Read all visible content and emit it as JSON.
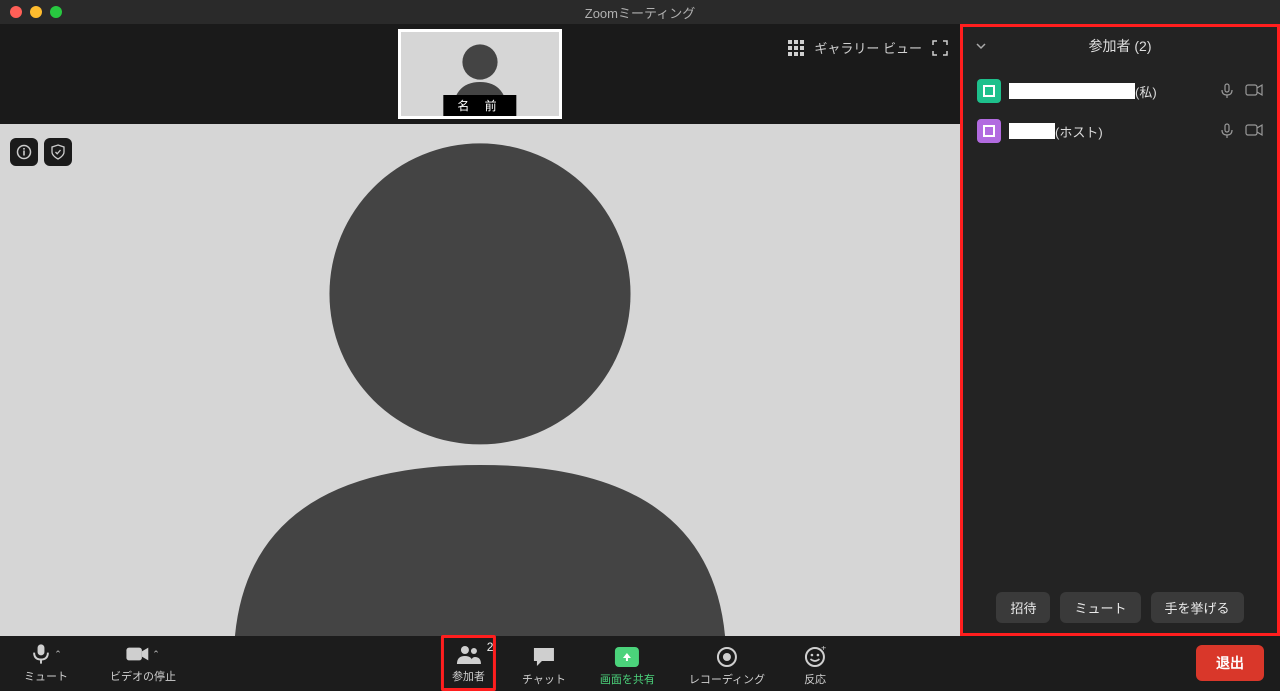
{
  "titlebar": {
    "title": "Zoomミーティング"
  },
  "thumbnail": {
    "label": "名 前"
  },
  "view_controls": {
    "gallery_label": "ギャラリー ビュー"
  },
  "participants_panel": {
    "title": "参加者 (2)",
    "rows": [
      {
        "suffix": "(私)",
        "avatar_color": "green"
      },
      {
        "suffix": "(ホスト)",
        "avatar_color": "purple"
      }
    ],
    "footer": {
      "invite": "招待",
      "mute": "ミュート",
      "raise_hand": "手を挙げる"
    }
  },
  "toolbar": {
    "mute": "ミュート",
    "stop_video": "ビデオの停止",
    "participants": "参加者",
    "participants_count": "2",
    "chat": "チャット",
    "share_screen": "画面を共有",
    "recording": "レコーディング",
    "reactions": "反応",
    "leave": "退出"
  }
}
